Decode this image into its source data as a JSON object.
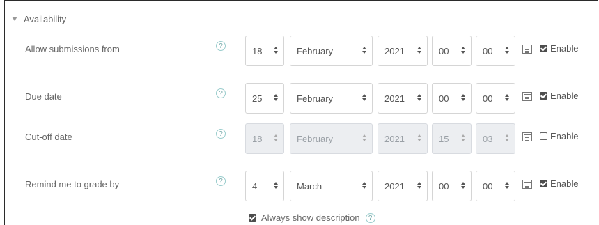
{
  "section": {
    "title": "Availability"
  },
  "rows": [
    {
      "label": "Allow submissions from",
      "day": "18",
      "month": "February",
      "year": "2021",
      "hour": "00",
      "minute": "00",
      "enable_label": "Enable",
      "enabled": true
    },
    {
      "label": "Due date",
      "day": "25",
      "month": "February",
      "year": "2021",
      "hour": "00",
      "minute": "00",
      "enable_label": "Enable",
      "enabled": true
    },
    {
      "label": "Cut-off date",
      "day": "18",
      "month": "February",
      "year": "2021",
      "hour": "15",
      "minute": "03",
      "enable_label": "Enable",
      "enabled": false
    },
    {
      "label": "Remind me to grade by",
      "day": "4",
      "month": "March",
      "year": "2021",
      "hour": "00",
      "minute": "00",
      "enable_label": "Enable",
      "enabled": true
    }
  ],
  "always_show": {
    "label": "Always show description",
    "checked": true
  },
  "icons": {
    "help": "question-circle-icon",
    "calendar": "calendar-icon"
  }
}
